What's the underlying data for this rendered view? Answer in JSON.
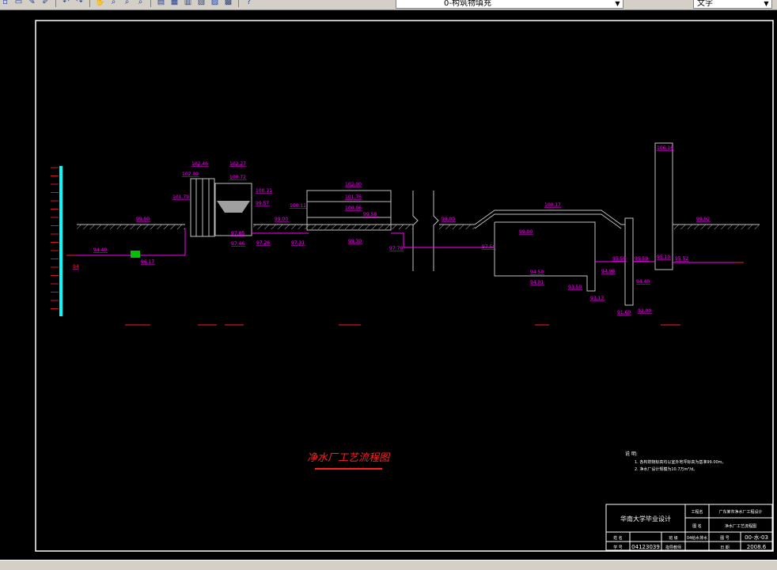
{
  "toolbar": {
    "layer_value": "0-构筑物填充",
    "text_style_value": "文字"
  },
  "drawing": {
    "title": "净水厂工艺流程图",
    "colors": {
      "magenta": "#ff00ff",
      "white": "#ffffff",
      "cyan": "#00ffff",
      "red": "#ff2020",
      "green": "#00c000",
      "ground": "#c0c0c0"
    },
    "levels": [
      {
        "id": "l1",
        "text": "99.00"
      },
      {
        "id": "l2",
        "text": "94.40"
      },
      {
        "id": "l3",
        "text": "96.17"
      },
      {
        "id": "l4",
        "text": "101.79"
      },
      {
        "id": "l5",
        "text": "102.09"
      },
      {
        "id": "l6",
        "text": "102.46"
      },
      {
        "id": "l7",
        "text": "102.27"
      },
      {
        "id": "l8",
        "text": "100.72"
      },
      {
        "id": "l9",
        "text": "100.31"
      },
      {
        "id": "l10",
        "text": "99.57"
      },
      {
        "id": "l11",
        "text": "97.85"
      },
      {
        "id": "l12",
        "text": "97.46"
      },
      {
        "id": "l13",
        "text": "99.00"
      },
      {
        "id": "l14",
        "text": "97.26"
      },
      {
        "id": "l15",
        "text": "97.31"
      },
      {
        "id": "l16",
        "text": "100.11"
      },
      {
        "id": "l17",
        "text": "102.00"
      },
      {
        "id": "l18",
        "text": "101.76"
      },
      {
        "id": "l19",
        "text": "100.06"
      },
      {
        "id": "l20",
        "text": "99.58"
      },
      {
        "id": "l21",
        "text": "98.30"
      },
      {
        "id": "l22",
        "text": "97.70"
      },
      {
        "id": "l23",
        "text": "99.00"
      },
      {
        "id": "l24",
        "text": "97.50"
      },
      {
        "id": "l25",
        "text": "100.17"
      },
      {
        "id": "l26",
        "text": "99.00"
      },
      {
        "id": "l27",
        "text": "94.50"
      },
      {
        "id": "l28",
        "text": "94.01"
      },
      {
        "id": "l29",
        "text": "93.50"
      },
      {
        "id": "l30",
        "text": "93.13"
      },
      {
        "id": "l31",
        "text": "95.50"
      },
      {
        "id": "l32",
        "text": "94.98"
      },
      {
        "id": "l33",
        "text": "95.59"
      },
      {
        "id": "l34",
        "text": "94.40"
      },
      {
        "id": "l35",
        "text": "91.60"
      },
      {
        "id": "l36",
        "text": "92.00"
      },
      {
        "id": "l37",
        "text": "106.16"
      },
      {
        "id": "l38",
        "text": "95.10"
      },
      {
        "id": "l39",
        "text": "95.52"
      },
      {
        "id": "l40",
        "text": "99.02"
      },
      {
        "id": "l41",
        "text": "94"
      }
    ],
    "notes": {
      "heading": "说 明:",
      "line1": "1. 各构筑物标高均以室外地坪标高为基准99.00m。",
      "line2": "2. 净水厂设计规模为10.7万m³/d。"
    },
    "title_block": {
      "project_label": "工程名",
      "project_value": "广东某市净水厂工程设计",
      "university": "华南大学毕业设计",
      "drawing_label": "图 名",
      "drawing_value": "净水厂工艺流程图",
      "name_label": "姓 名",
      "number_label": "学 号",
      "number_value": "04123039",
      "class_label": "班 级",
      "class_value": "04给水排水",
      "tutor_label": "指导教师",
      "sheet_label": "图 号",
      "sheet_value": "00-水-03",
      "date_label": "日 期",
      "date_value": "2008.6"
    }
  }
}
